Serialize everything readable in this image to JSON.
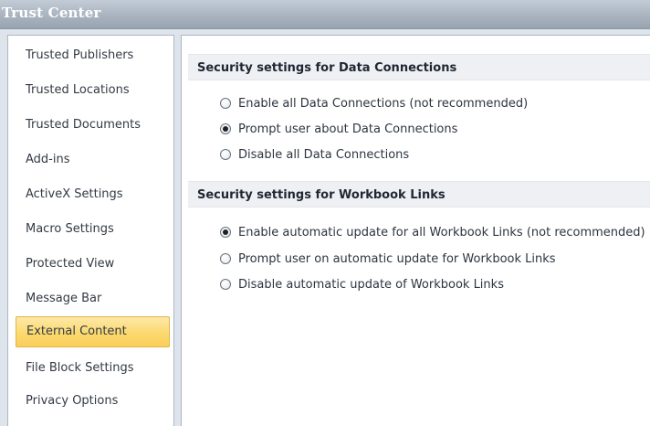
{
  "window": {
    "title": "Trust Center"
  },
  "sidebar": {
    "items": [
      {
        "label": "Trusted Publishers",
        "selected": false
      },
      {
        "label": "Trusted Locations",
        "selected": false
      },
      {
        "label": "Trusted Documents",
        "selected": false
      },
      {
        "label": "Add-ins",
        "selected": false
      },
      {
        "label": "ActiveX Settings",
        "selected": false
      },
      {
        "label": "Macro Settings",
        "selected": false
      },
      {
        "label": "Protected View",
        "selected": false
      },
      {
        "label": "Message Bar",
        "selected": false
      },
      {
        "label": "External Content",
        "selected": true
      },
      {
        "label": "File Block Settings",
        "selected": false
      },
      {
        "label": "Privacy Options",
        "selected": false
      }
    ]
  },
  "data_connections": {
    "header": "Security settings for Data Connections",
    "options": [
      {
        "label": "Enable all Data Connections (not recommended)",
        "checked": false
      },
      {
        "label": "Prompt user about Data Connections",
        "checked": true
      },
      {
        "label": "Disable all Data Connections",
        "checked": false
      }
    ]
  },
  "workbook_links": {
    "header": "Security settings for Workbook Links",
    "options": [
      {
        "label": "Enable automatic update for all Workbook Links (not recommended)",
        "checked": true
      },
      {
        "label": "Prompt user on automatic update for Workbook Links",
        "checked": false
      },
      {
        "label": "Disable automatic update of Workbook Links",
        "checked": false
      }
    ]
  },
  "colors": {
    "selected_item_bg": "#fcd96f",
    "section_header_bg": "#eef0f3",
    "titlebar_bg": "#a9b4c0"
  }
}
